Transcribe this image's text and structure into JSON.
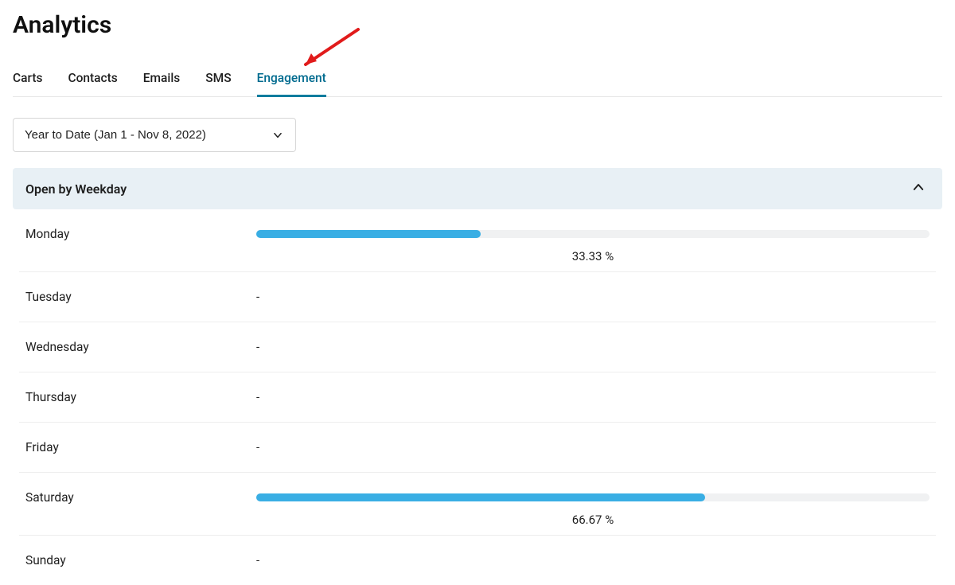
{
  "header": {
    "title": "Analytics"
  },
  "tabs": [
    {
      "id": "carts",
      "label": "Carts",
      "active": false
    },
    {
      "id": "contacts",
      "label": "Contacts",
      "active": false
    },
    {
      "id": "emails",
      "label": "Emails",
      "active": false
    },
    {
      "id": "sms",
      "label": "SMS",
      "active": false
    },
    {
      "id": "engagement",
      "label": "Engagement",
      "active": true
    }
  ],
  "date_range": {
    "label": "Year to Date (Jan 1 - Nov 8, 2022)"
  },
  "card": {
    "title": "Open by Weekday",
    "collapsed": false
  },
  "colors": {
    "bar": "#39aee4",
    "track": "#f0f1f2",
    "accent": "#007c9e"
  },
  "chart_data": {
    "type": "bar",
    "orientation": "horizontal",
    "unit": "%",
    "xlabel": "",
    "ylabel": "",
    "xlim": [
      0,
      100
    ],
    "categories": [
      "Monday",
      "Tuesday",
      "Wednesday",
      "Thursday",
      "Friday",
      "Saturday",
      "Sunday"
    ],
    "values": [
      33.33,
      null,
      null,
      null,
      null,
      66.67,
      null
    ],
    "value_labels": [
      "33.33 %",
      "-",
      "-",
      "-",
      "-",
      "66.67 %",
      "-"
    ]
  },
  "annotation": {
    "type": "arrow",
    "color": "#e11b1b",
    "points_to": "tab-engagement"
  }
}
